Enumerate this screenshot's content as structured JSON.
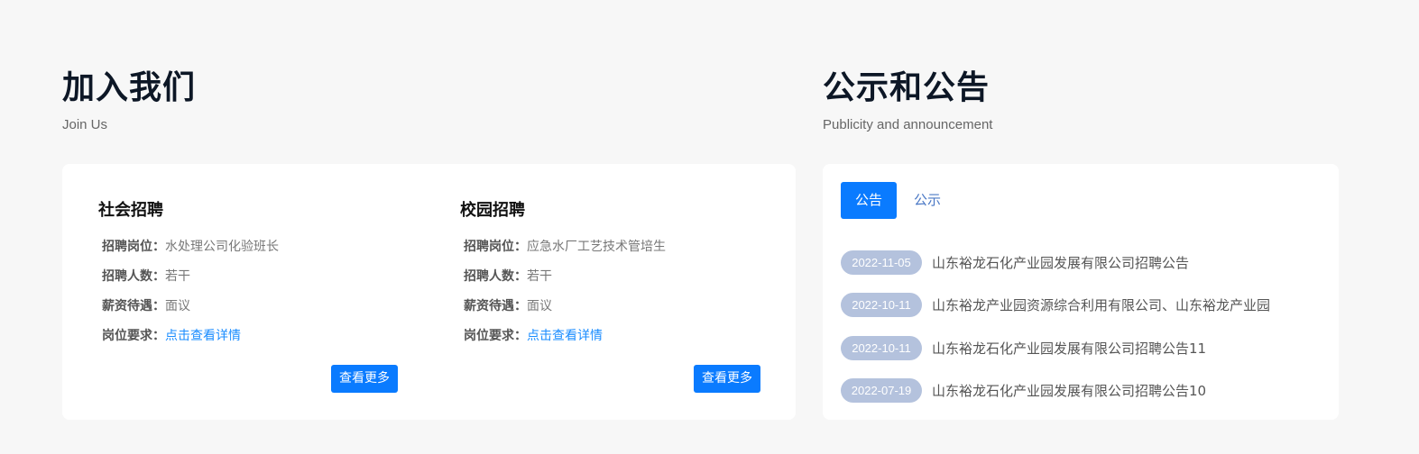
{
  "join": {
    "title": "加入我们",
    "subtitle": "Join Us",
    "social": {
      "heading": "社会招聘",
      "rows": [
        {
          "key": "招聘岗位：",
          "value": "水处理公司化验班长"
        },
        {
          "key": "招聘人数：",
          "value": "若干"
        },
        {
          "key": "薪资待遇：",
          "value": "面议"
        },
        {
          "key": "岗位要求：",
          "value": "点击查看详情"
        }
      ],
      "more": "查看更多"
    },
    "campus": {
      "heading": "校园招聘",
      "rows": [
        {
          "key": "招聘岗位：",
          "value": "应急水厂工艺技术管培生"
        },
        {
          "key": "招聘人数：",
          "value": "若干"
        },
        {
          "key": "薪资待遇：",
          "value": "面议"
        },
        {
          "key": "岗位要求：",
          "value": "点击查看详情"
        }
      ],
      "more": "查看更多"
    }
  },
  "pub": {
    "title": "公示和公告",
    "subtitle": "Publicity and announcement",
    "tabs": [
      "公告",
      "公示"
    ],
    "notices": [
      {
        "date": "2022-11-05",
        "title": "山东裕龙石化产业园发展有限公司招聘公告"
      },
      {
        "date": "2022-10-11",
        "title": "山东裕龙产业园资源综合利用有限公司、山东裕龙产业园"
      },
      {
        "date": "2022-10-11",
        "title": "山东裕龙石化产业园发展有限公司招聘公告11"
      },
      {
        "date": "2022-07-19",
        "title": "山东裕龙石化产业园发展有限公司招聘公告10"
      }
    ]
  },
  "colors": {
    "accent": "#0a7bff",
    "link": "#1a8cff",
    "date_badge": "#b4c2dd",
    "page_bg": "#f7f7f7"
  }
}
